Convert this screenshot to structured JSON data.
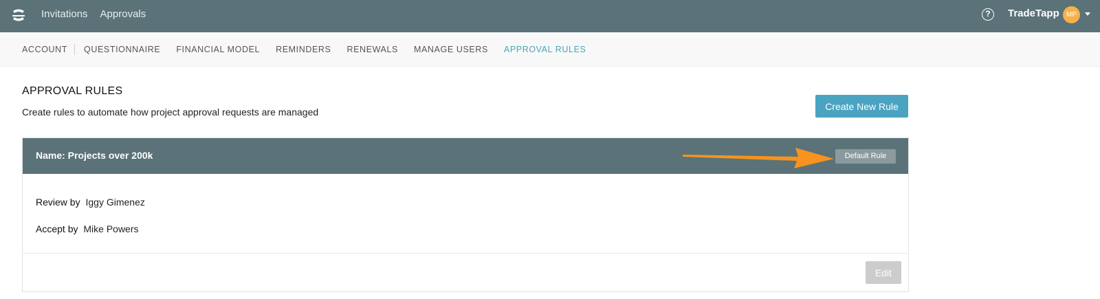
{
  "topbar": {
    "nav": [
      "Invitations",
      "Approvals"
    ],
    "help_icon": "question-circle-icon",
    "company": "TradeTapp",
    "avatar_initials": "MP",
    "bg_color": "#5a7278"
  },
  "subnav": {
    "items": [
      "ACCOUNT",
      "QUESTIONNAIRE",
      "FINANCIAL MODEL",
      "REMINDERS",
      "RENEWALS",
      "MANAGE USERS",
      "APPROVAL RULES"
    ],
    "active": "APPROVAL RULES",
    "active_color": "#4aa3b8"
  },
  "page": {
    "title": "APPROVAL RULES",
    "subtitle": "Create rules to automate how project approval requests are managed",
    "create_button": "Create New Rule"
  },
  "rule": {
    "name": "Name: Projects over 200k",
    "badge": "Default Rule",
    "review_label": "Review by",
    "review_value": "Iggy Gimenez",
    "accept_label": "Accept by",
    "accept_value": "Mike Powers",
    "edit_button": "Edit"
  },
  "annotation": {
    "arrow_color": "#f7931e"
  }
}
